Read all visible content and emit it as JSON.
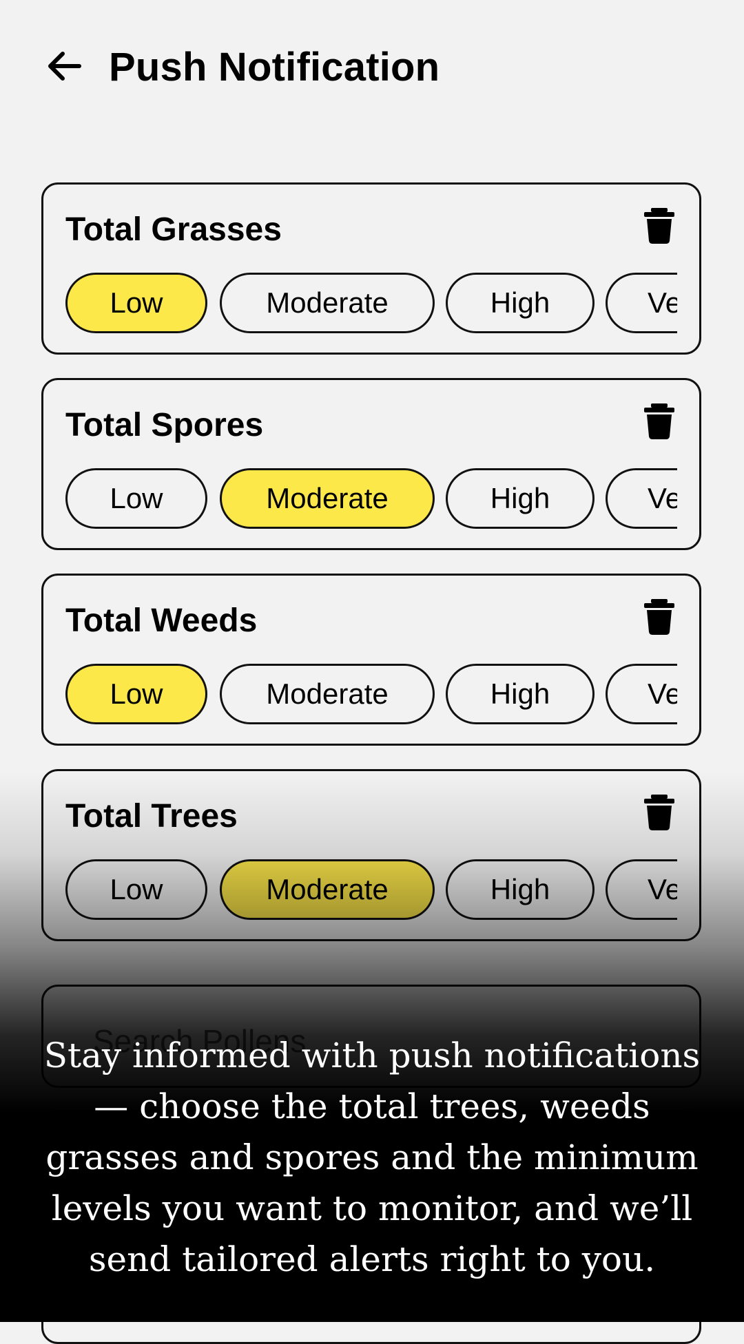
{
  "header": {
    "title": "Push Notification",
    "back_icon": "arrow-left-icon"
  },
  "levels": [
    "Low",
    "Moderate",
    "High",
    "Ve"
  ],
  "cards": [
    {
      "title": "Total Grasses",
      "selected": "Low"
    },
    {
      "title": "Total Spores",
      "selected": "Moderate"
    },
    {
      "title": "Total Weeds",
      "selected": "Low"
    },
    {
      "title": "Total Trees",
      "selected": "Moderate"
    }
  ],
  "search": {
    "placeholder": "Search Pollens"
  },
  "caption": "Stay informed with push notifications — choose the total trees, weeds grasses and spores and the minimum levels you want to monitor, and we’ll send tailored alerts right to you.",
  "colors": {
    "selected_chip": "#fde84a",
    "background": "#f2f2f2",
    "border": "#111111"
  }
}
